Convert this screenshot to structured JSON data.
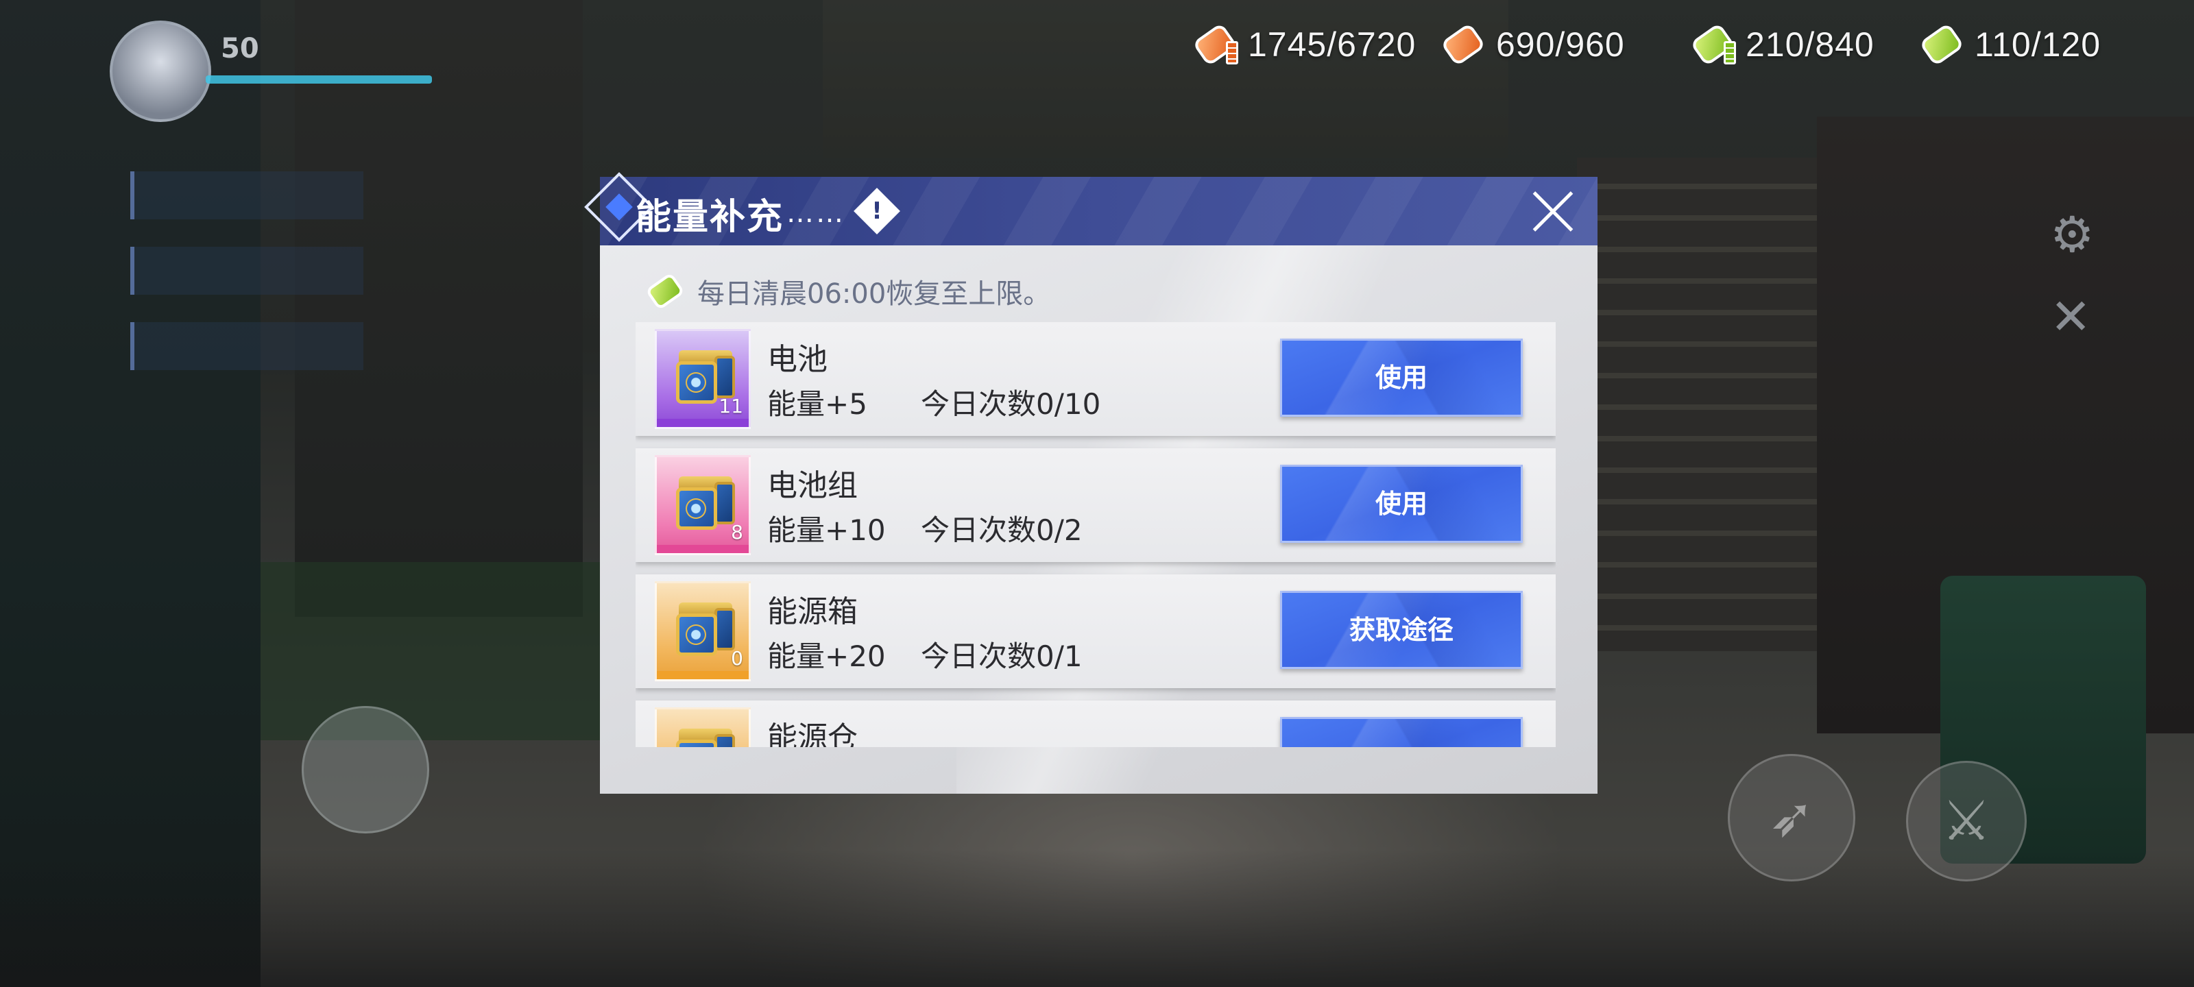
{
  "currencies": [
    {
      "icon": "orange-energy-capsule-icon",
      "value": "1745/6720",
      "color": "#e4601e"
    },
    {
      "icon": "orange-capsule-icon",
      "value": "690/960",
      "color": "#e4601e"
    },
    {
      "icon": "green-energy-capsule-icon",
      "value": "210/840",
      "color": "#7cbb1e"
    },
    {
      "icon": "green-capsule-icon",
      "value": "110/120",
      "color": "#7cbb1e"
    }
  ],
  "player": {
    "level": "50"
  },
  "dialog": {
    "title": "能量补充",
    "title_dots": "……",
    "info_icon": "!",
    "notice_icon": "green-capsule-icon",
    "notice": "每日清晨06:00恢复至上限。",
    "items": [
      {
        "name": "电池",
        "count": "11",
        "effect": "能量+5",
        "usage": "今日次数0/10",
        "button": "使用",
        "rarity": "purple"
      },
      {
        "name": "电池组",
        "count": "8",
        "effect": "能量+10",
        "usage": "今日次数0/2",
        "button": "使用",
        "rarity": "pink"
      },
      {
        "name": "能源箱",
        "count": "0",
        "effect": "能量+20",
        "usage": "今日次数0/1",
        "button": "获取途径",
        "rarity": "orange"
      },
      {
        "name": "能源仓",
        "count": "",
        "effect": "",
        "usage": "",
        "button": "",
        "rarity": "orange"
      }
    ]
  },
  "colors": {
    "header": "#2d3a7e",
    "button": "#4b7af2",
    "panel": "#e6e7ea"
  }
}
